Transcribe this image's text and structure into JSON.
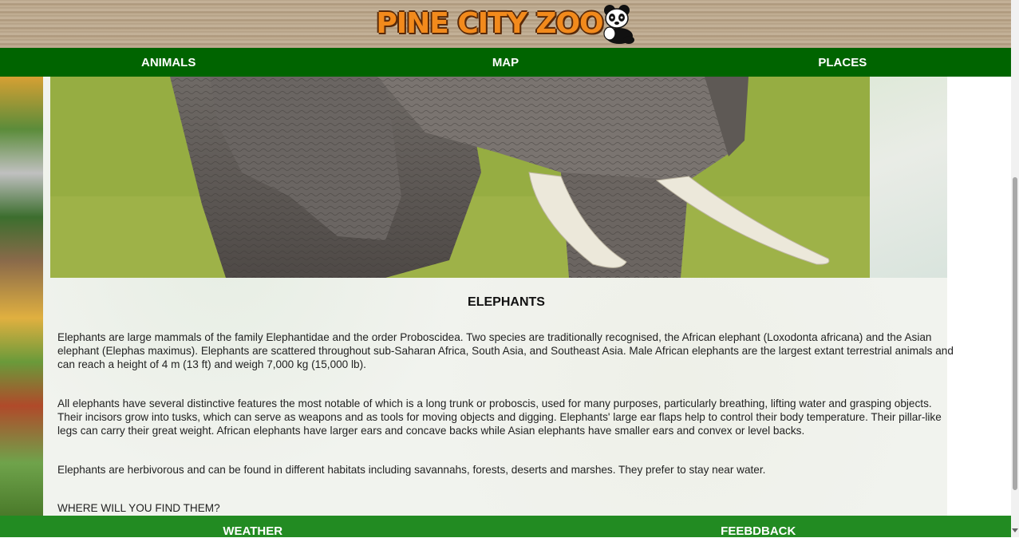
{
  "header": {
    "logo_text": "PINE CITY ZOO"
  },
  "topnav": {
    "items": [
      {
        "label": "ANIMALS"
      },
      {
        "label": "MAP"
      },
      {
        "label": "PLACES"
      }
    ]
  },
  "article": {
    "title": "ELEPHANTS",
    "paragraphs": [
      "Elephants are large mammals of the family Elephantidae and the order Proboscidea. Two species are traditionally recognised, the African elephant (Loxodonta africana) and the Asian elephant (Elephas maximus). Elephants are scattered throughout sub-Saharan Africa, South Asia, and Southeast Asia. Male African elephants are the largest extant terrestrial animals and can reach a height of 4 m (13 ft) and weigh 7,000 kg (15,000 lb).",
      "All elephants have several distinctive features the most notable of which is a long trunk or proboscis, used for many purposes, particularly breathing, lifting water and grasping objects. Their incisors grow into tusks, which can serve as weapons and as tools for moving objects and digging. Elephants' large ear flaps help to control their body temperature. Their pillar-like legs can carry their great weight. African elephants have larger ears and concave backs while Asian elephants have smaller ears and convex or level backs.",
      "Elephants are herbivorous and can be found in different habitats including savannahs, forests, deserts and marshes. They prefer to stay near water."
    ],
    "where_heading": "WHERE WILL YOU FIND THEM?"
  },
  "footer": {
    "items": [
      {
        "label": "WEATHER"
      },
      {
        "label": "FEEBDBACK"
      }
    ]
  },
  "colors": {
    "nav_green": "#006400",
    "footer_green": "#228b22",
    "logo_orange": "#f28a1c"
  }
}
